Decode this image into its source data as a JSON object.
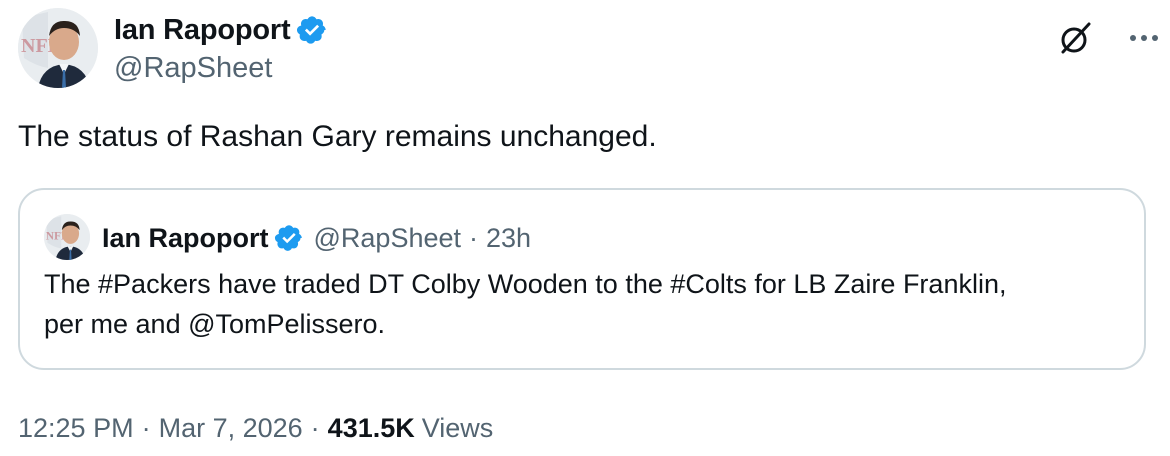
{
  "author": {
    "display_name": "Ian Rapoport",
    "handle": "@RapSheet"
  },
  "tweet": {
    "text": "The status of Rashan Gary remains unchanged."
  },
  "quoted": {
    "display_name": "Ian Rapoport",
    "handle": "@RapSheet",
    "separator": "·",
    "time_ago": "23h",
    "text": "The #Packers have traded DT Colby Wooden to the #Colts for LB Zaire Franklin, per me and @TomPelissero."
  },
  "meta": {
    "time": "12:25 PM",
    "separator": "·",
    "date": "Mar 7, 2026",
    "views_count": "431.5K",
    "views_label": "Views"
  },
  "icons": {
    "verified": "verified-badge-icon",
    "grok": "grok-icon",
    "more": "more-options-icon"
  },
  "colors": {
    "text_primary": "#0f1419",
    "text_secondary": "#536471",
    "verified_blue": "#1d9bf0",
    "border": "#cfd9de"
  }
}
